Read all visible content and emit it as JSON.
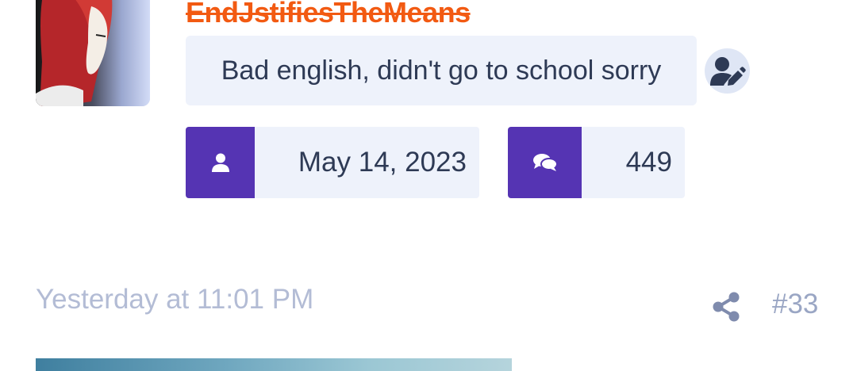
{
  "profile": {
    "username": "EndJstifiesTheMeans",
    "custom_title": "Bad english, didn't go to school sorry",
    "joined": "May 14, 2023",
    "messages": "449"
  },
  "post": {
    "timestamp": "Yesterday at 11:01 PM",
    "number": "#33"
  },
  "icons": {
    "joined": "user-icon",
    "messages": "comments-icon",
    "edit": "user-edit-icon",
    "share": "share-icon"
  },
  "colors": {
    "username": "#f25a12",
    "accent": "#5534b3",
    "box_bg": "#eef2fb",
    "muted_text": "#b3bcd5"
  }
}
